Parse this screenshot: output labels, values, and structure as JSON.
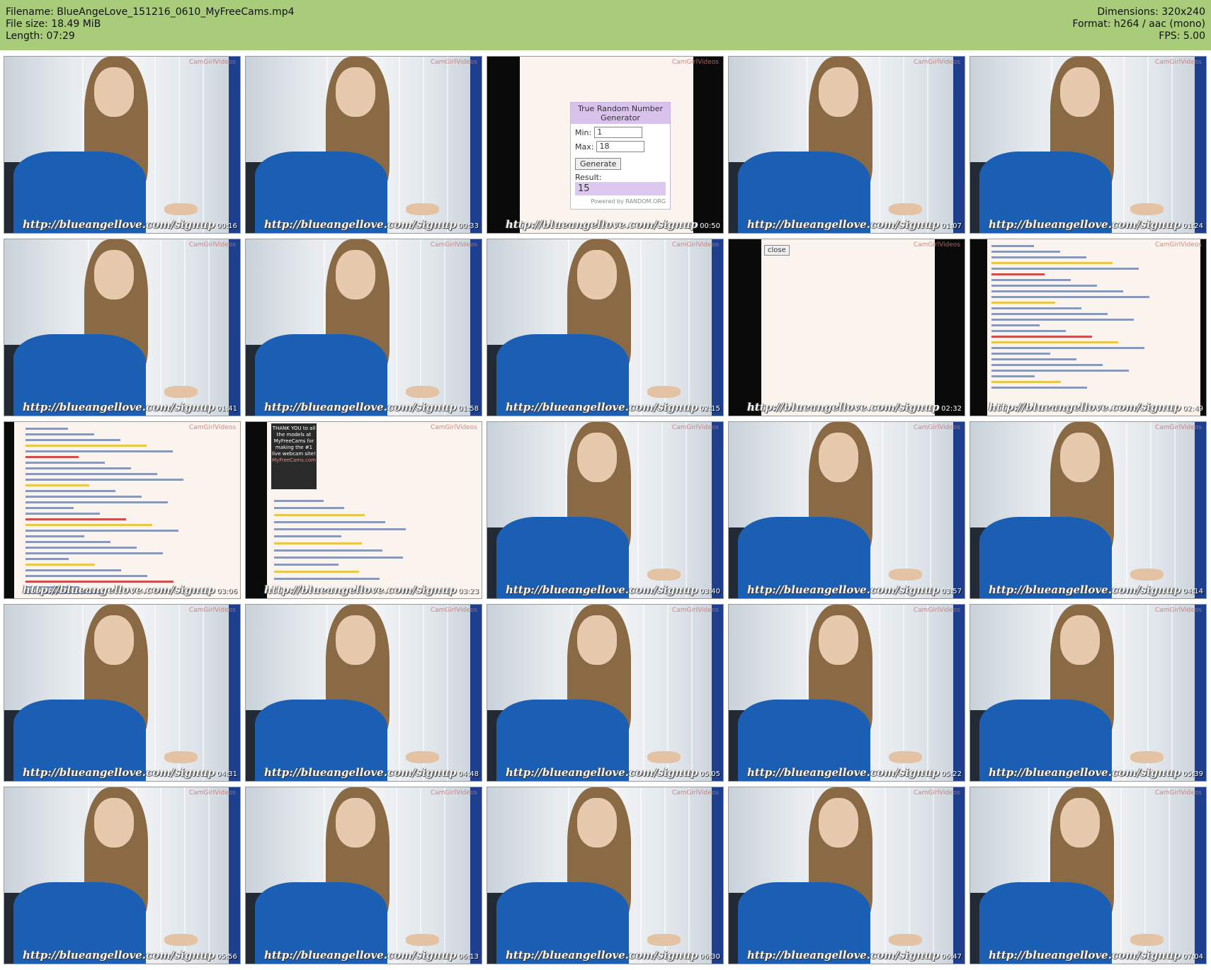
{
  "header": {
    "filename_label": "Filename: BlueAngeLove_151216_0610_MyFreeCams.mp4",
    "filesize_label": "File size: 18.49 MiB",
    "length_label": "Length: 07:29",
    "dimensions_label": "Dimensions: 320x240",
    "format_label": "Format: h264 / aac (mono)",
    "fps_label": "FPS: 5.00"
  },
  "watermark_text": "http://blueangellove.com/signup",
  "brand_text": "CamGirlVideos",
  "frames": [
    {
      "time": "00:16",
      "kind": "cam"
    },
    {
      "time": "00:33",
      "kind": "cam"
    },
    {
      "time": "00:50",
      "kind": "rng"
    },
    {
      "time": "01:07",
      "kind": "cam"
    },
    {
      "time": "01:24",
      "kind": "cam"
    },
    {
      "time": "01:41",
      "kind": "cam"
    },
    {
      "time": "01:58",
      "kind": "cam"
    },
    {
      "time": "02:15",
      "kind": "cam"
    },
    {
      "time": "02:32",
      "kind": "popup"
    },
    {
      "time": "02:49",
      "kind": "chat"
    },
    {
      "time": "03:06",
      "kind": "table"
    },
    {
      "time": "03:23",
      "kind": "promo"
    },
    {
      "time": "03:40",
      "kind": "cam"
    },
    {
      "time": "03:57",
      "kind": "cam"
    },
    {
      "time": "04:14",
      "kind": "cam"
    },
    {
      "time": "04:31",
      "kind": "cam"
    },
    {
      "time": "04:48",
      "kind": "cam"
    },
    {
      "time": "05:05",
      "kind": "cam"
    },
    {
      "time": "05:22",
      "kind": "cam"
    },
    {
      "time": "05:39",
      "kind": "cam"
    },
    {
      "time": "05:56",
      "kind": "cam"
    },
    {
      "time": "06:13",
      "kind": "cam"
    },
    {
      "time": "06:30",
      "kind": "cam"
    },
    {
      "time": "06:47",
      "kind": "cam"
    },
    {
      "time": "07:04",
      "kind": "cam"
    }
  ],
  "rng": {
    "title": "True Random Number Generator",
    "min_label": "Min:",
    "min_value": "1",
    "max_label": "Max:",
    "max_value": "18",
    "button_label": "Generate",
    "result_label": "Result:",
    "result_value": "15",
    "powered_label": "Powered by RANDOM.ORG"
  },
  "popup": {
    "close_label": "close"
  },
  "promo": {
    "text": "THANK YOU to all the models at MyFreeCams for making the #1 live webcam site!",
    "site": "MyFreeCams.com"
  }
}
